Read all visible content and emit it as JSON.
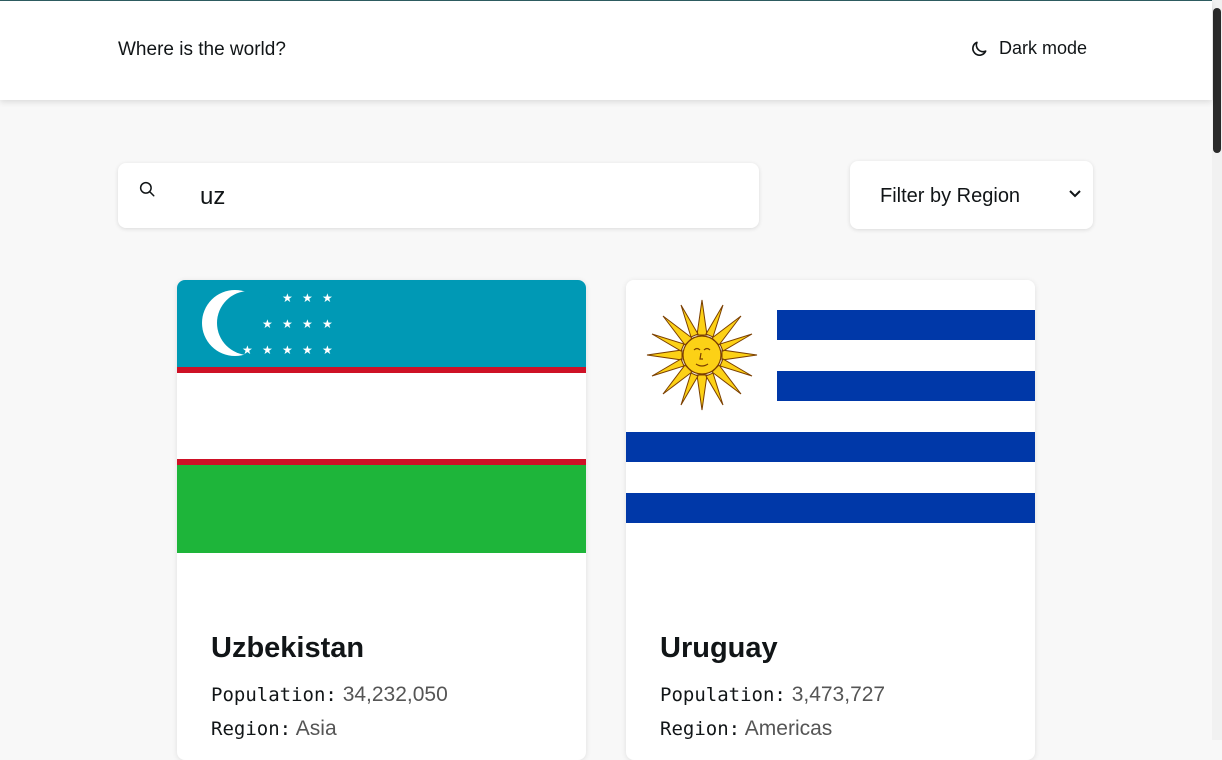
{
  "header": {
    "title": "Where is the world?",
    "theme_toggle_label": "Dark mode",
    "theme_icon": "moon-icon"
  },
  "search": {
    "value": "uz",
    "placeholder": "",
    "icon": "search-icon"
  },
  "filter": {
    "selected": "Filter by Region",
    "icon": "chevron-down-icon"
  },
  "countries": [
    {
      "name": "Uzbekistan",
      "population_label": "Population:",
      "population": "34,232,050",
      "region_label": "Region:",
      "region": "Asia",
      "flag": "uzbekistan-flag",
      "colors": {
        "blue": "#0099b5",
        "red": "#ce1126",
        "white": "#ffffff",
        "green": "#1eb53a"
      }
    },
    {
      "name": "Uruguay",
      "population_label": "Population:",
      "population": "3,473,727",
      "region_label": "Region:",
      "region": "Americas",
      "flag": "uruguay-flag",
      "colors": {
        "blue": "#0038a8",
        "white": "#ffffff",
        "sun": "#fcd116",
        "sun_edge": "#7b3f00"
      }
    }
  ]
}
